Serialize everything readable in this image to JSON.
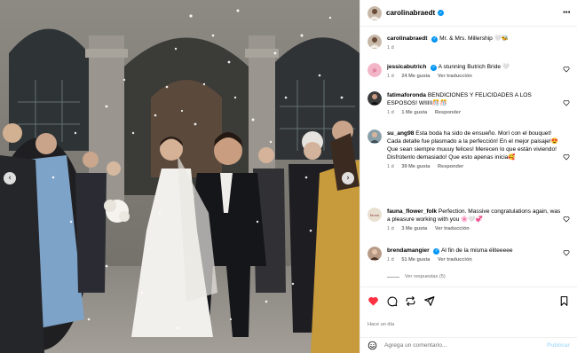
{
  "post": {
    "author": "carolinabraedt",
    "verified": true,
    "more_icon": "more-horizontal-icon",
    "caption": {
      "text": "Mr. & Mrs. Millership 🤍🐝",
      "time": "1 d"
    },
    "time_ago": "Hace un día"
  },
  "comments": [
    {
      "user": "jessicabutrich",
      "verified": true,
      "text": "A stunning Butrich Bride 🤍",
      "time": "1 d",
      "likes": "24 Me gusta",
      "translate": "Ver traducción",
      "avatar_color": "#f3b6c8"
    },
    {
      "user": "fatimaforonda",
      "verified": false,
      "text": "BENDICIONES Y FELICIDADES A LOS ESPOSOS! WIIIII🎊🎊",
      "time": "1 d",
      "likes": "1 Me gusta",
      "reply": "Responder",
      "avatar_color": "#3a3a3a"
    },
    {
      "user": "su_ang98",
      "verified": false,
      "text": "Esta boda ha sido de ensueño. Morí con el bouquet! Cada detalle fue plasmado a la perfección! En el mejor paisaje!😍 Que sean siempre muuuy felices! Merecen lo que están viviendo! Disfrútenlo demasiado! Que esto apenas inicia🥰",
      "time": "1 d",
      "likes": "39 Me gusta",
      "reply": "Responder",
      "avatar_color": "#8aa0a8"
    },
    {
      "user": "fauna_flower_folk",
      "verified": false,
      "text": "Perfection. Massive congratulations again, was a pleasure working with you 🌸🤍💞",
      "time": "1 d",
      "likes": "3 Me gusta",
      "translate": "Ver traducción",
      "avatar_color": "#e8e0d0"
    },
    {
      "user": "brendamangier",
      "verified": true,
      "text": "Al fin de la misma éliteeeee",
      "time": "1 d",
      "likes": "51 Me gusta",
      "translate": "Ver traducción",
      "avatar_color": "#b79a86"
    }
  ],
  "view_replies": "Ver respuestas (5)",
  "actions": {
    "like_icon": "heart-filled-icon",
    "comment_icon": "comment-icon",
    "share_icon": "repost-icon",
    "send_icon": "send-icon",
    "save_icon": "bookmark-icon",
    "like_color": "#ff3040"
  },
  "add_comment": {
    "placeholder": "Agrega un comentario...",
    "post_label": "Publicar",
    "emoji_icon": "smile-icon"
  },
  "photo": {
    "prev_icon": "chevron-left-icon",
    "next_icon": "chevron-right-icon"
  },
  "colors": {
    "verified": "#0095f6",
    "muted": "#737373",
    "post_disabled": "#b2dffc"
  }
}
